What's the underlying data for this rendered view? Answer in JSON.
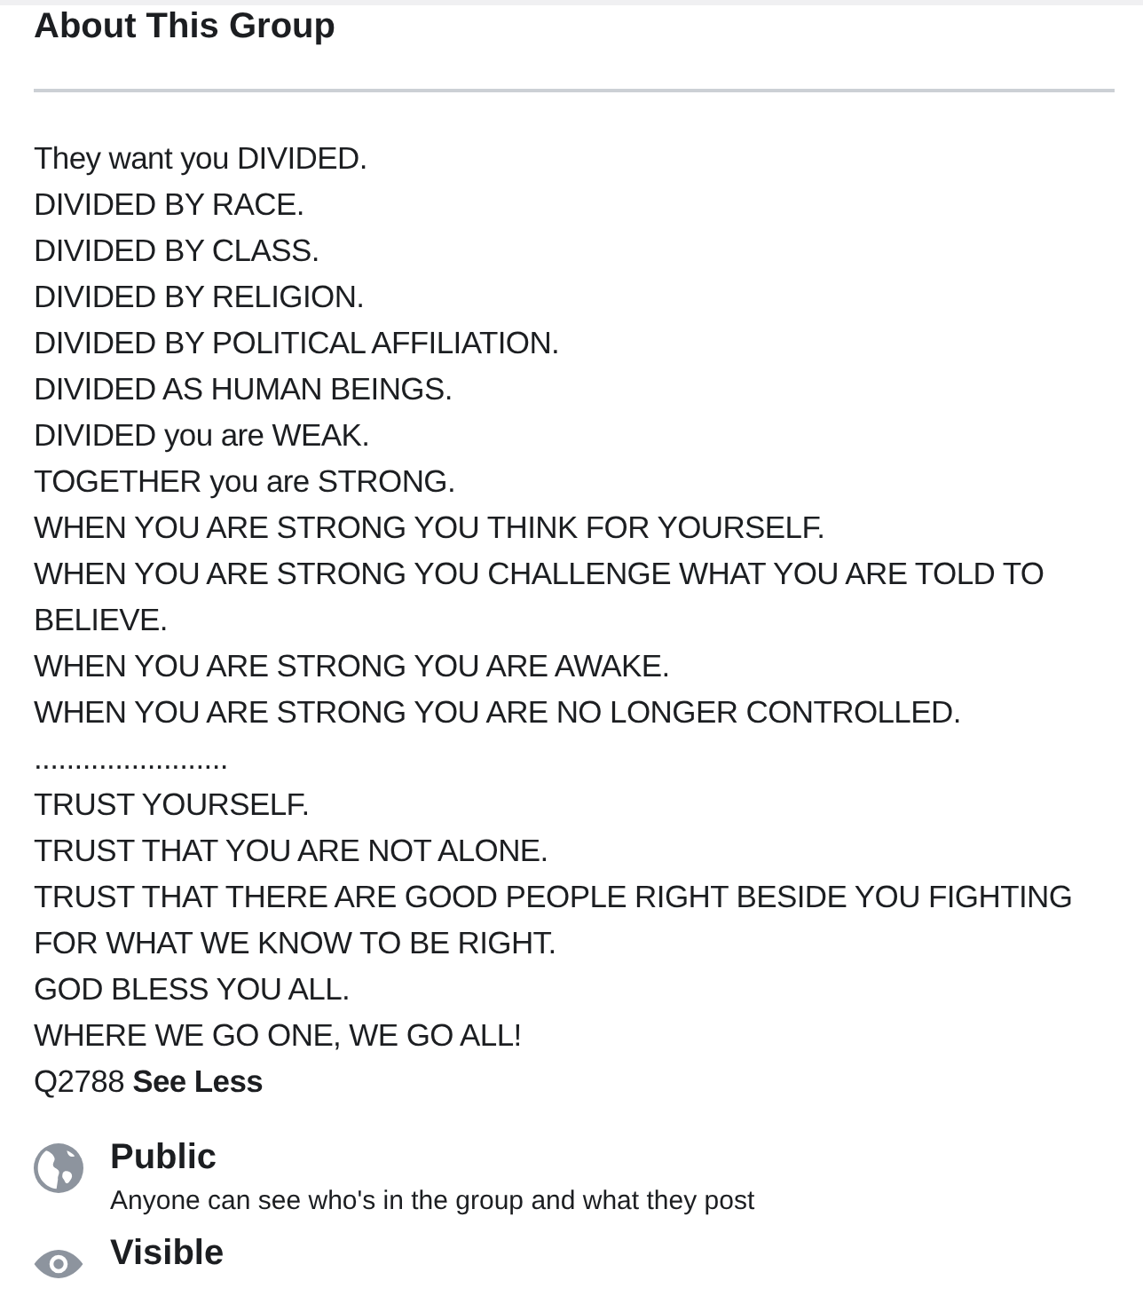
{
  "heading": "About This Group",
  "description": {
    "lines": [
      "They want you DIVIDED.",
      "DIVIDED BY RACE.",
      "DIVIDED BY CLASS.",
      "DIVIDED BY RELIGION.",
      "DIVIDED BY POLITICAL AFFILIATION.",
      "DIVIDED AS HUMAN BEINGS.",
      "DIVIDED you are WEAK.",
      "TOGETHER you are STRONG.",
      "WHEN YOU ARE STRONG YOU THINK FOR YOURSELF.",
      "WHEN YOU ARE STRONG YOU CHALLENGE WHAT YOU ARE TOLD TO BELIEVE.",
      "WHEN YOU ARE STRONG YOU ARE AWAKE.",
      "WHEN YOU ARE STRONG YOU ARE NO LONGER CONTROLLED.",
      "........................",
      "TRUST YOURSELF.",
      "TRUST THAT YOU ARE NOT ALONE.",
      "TRUST THAT THERE ARE GOOD PEOPLE RIGHT BESIDE YOU FIGHTING FOR WHAT WE KNOW TO BE RIGHT.",
      "GOD BLESS YOU ALL.",
      "WHERE WE GO ONE, WE GO ALL!"
    ],
    "last_line": {
      "text": "Q2788",
      "link": "See Less"
    }
  },
  "privacy": [
    {
      "kind": "public",
      "title": "Public",
      "detail": "Anyone can see who's in the group and what they post"
    },
    {
      "kind": "visible",
      "title": "Visible"
    }
  ]
}
